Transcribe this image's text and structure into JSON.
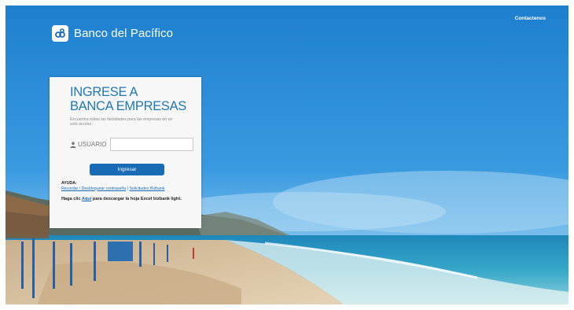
{
  "brand": {
    "name": "Banco del Pacífico"
  },
  "header": {
    "contact_link": "Contactenos"
  },
  "login": {
    "title_line1": "INGRESE A",
    "title_line2": "BANCA EMPRESAS",
    "subtitle": "Encuentra todas las facilidades para las empresas en un solo acceso",
    "user_label": "USUARIO",
    "user_value": "",
    "submit_label": "Ingresar"
  },
  "help": {
    "title": "AYUDA:",
    "links": [
      "Recordar / Desbloquear contraseña",
      "Solicitudes Bizbank"
    ],
    "separator": "|"
  },
  "excel_notice": {
    "prefix": "Haga clic ",
    "link": "Aquí",
    "suffix": " para descargar la hoja Excel bizbank light."
  },
  "colors": {
    "brand_blue": "#1f78b4",
    "button_blue": "#1a6bb5",
    "sky": "#2f8fd6",
    "card_bg": "#f7f7f7"
  },
  "icons": [
    "logo-mark-icon",
    "user-icon"
  ]
}
